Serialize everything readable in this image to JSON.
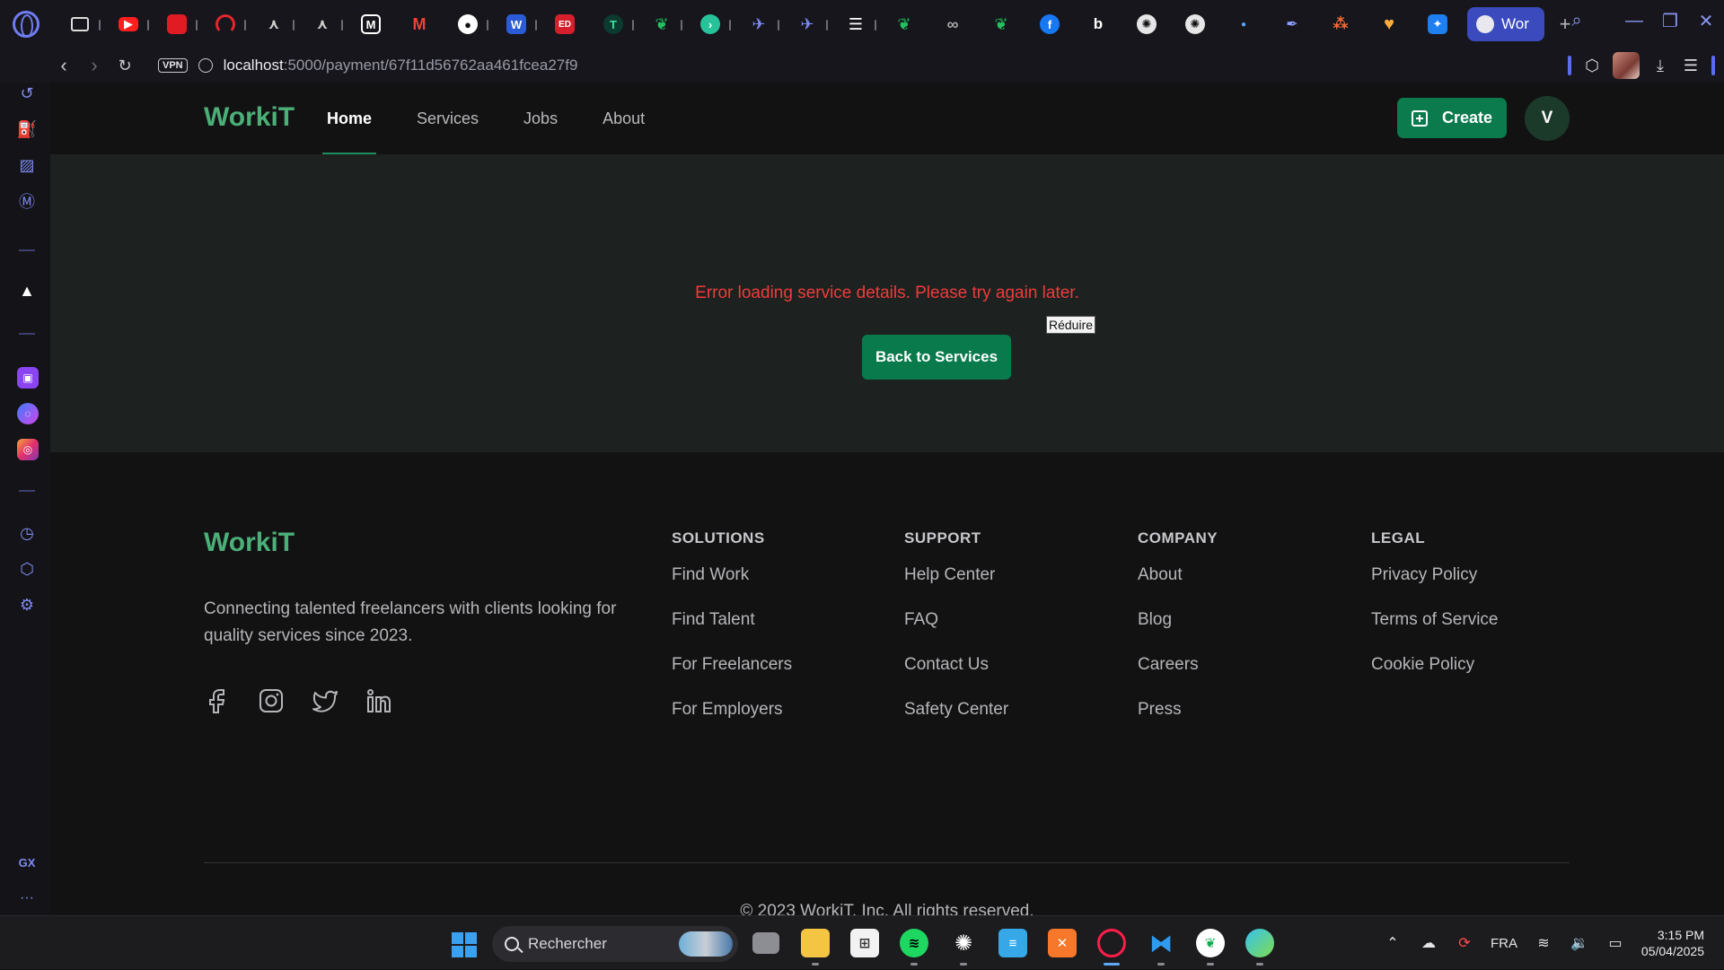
{
  "browser": {
    "active_tab_title": "Wor",
    "new_tab_symbol": "+",
    "vpn_badge": "VPN",
    "url_host": "localhost",
    "url_rest": ":5000/payment/67f11d56762aa461fcea27f9",
    "sidebar_bottom_label": "GX",
    "sidebar_more": "···",
    "accent_color": "#6f7cf2"
  },
  "site": {
    "brand": "WorkiT",
    "nav": {
      "home": "Home",
      "services": "Services",
      "jobs": "Jobs",
      "about": "About"
    },
    "create_label": "Create",
    "user_initial": "V",
    "error_message": "Error loading service details. Please try again later.",
    "back_button": "Back to Services",
    "tooltip": "Réduire",
    "brand_color": "#4caf78",
    "primary_color": "#0b7a4d",
    "error_color": "#ef3b3b"
  },
  "footer": {
    "brand": "WorkiT",
    "description": "Connecting talented freelancers with clients looking for quality services since 2023.",
    "columns": [
      {
        "title": "SOLUTIONS",
        "links": [
          "Find Work",
          "Find Talent",
          "For Freelancers",
          "For Employers"
        ]
      },
      {
        "title": "SUPPORT",
        "links": [
          "Help Center",
          "FAQ",
          "Contact Us",
          "Safety Center"
        ]
      },
      {
        "title": "COMPANY",
        "links": [
          "About",
          "Blog",
          "Careers",
          "Press"
        ]
      },
      {
        "title": "LEGAL",
        "links": [
          "Privacy Policy",
          "Terms of Service",
          "Cookie Policy"
        ]
      }
    ],
    "copyright": "© 2023 WorkiT, Inc. All rights reserved."
  },
  "taskbar": {
    "search_placeholder": "Rechercher",
    "language": "FRA",
    "time": "3:15 PM",
    "date": "05/04/2025"
  }
}
